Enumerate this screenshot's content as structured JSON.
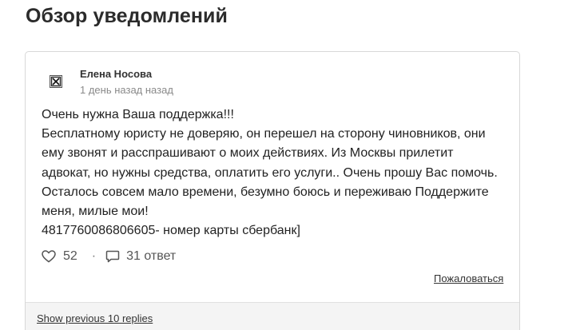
{
  "page": {
    "title": "Обзор уведомлений"
  },
  "post": {
    "author": "Елена Носова",
    "time": "1 день назад назад",
    "avatar_icon": "broken-image-icon",
    "text_lines": [
      "Очень нужна Ваша поддержка!!!",
      "Бесплатному юристу не доверяю, он перешел на сторону чиновников, они ему звонят и расспрашивают о моих действиях. Из Москвы прилетит адвокат, но нужны средства, оплатить его услуги.. Очень прошу Вас помочь. Осталось совсем мало времени, безумно боюсь и переживаю Поддержите меня, милые мои!",
      "4817760086806605- номер карты сбербанк]"
    ],
    "likes": "52",
    "separator": "·",
    "replies": "31 ответ",
    "report_label": "Пожаловаться",
    "like_icon": "heart-icon",
    "reply_icon": "comment-icon"
  },
  "footer": {
    "show_previous_label": "Show previous 10 replies"
  }
}
